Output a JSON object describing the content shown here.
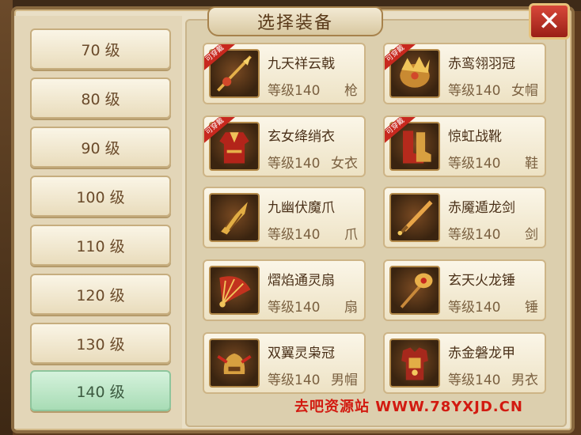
{
  "window": {
    "title": "选择装备",
    "close_label": "✕"
  },
  "levels": [
    {
      "label": "70 级",
      "active": false
    },
    {
      "label": "80 级",
      "active": false
    },
    {
      "label": "90 级",
      "active": false
    },
    {
      "label": "100 级",
      "active": false
    },
    {
      "label": "110 级",
      "active": false
    },
    {
      "label": "120 级",
      "active": false
    },
    {
      "label": "130 级",
      "active": false
    },
    {
      "label": "140 级",
      "active": true
    }
  ],
  "items": [
    {
      "name": "九天祥云戟",
      "level": "等级140",
      "type": "枪",
      "wearable": true,
      "badge": "可穿戴",
      "icon": "spear-icon"
    },
    {
      "name": "赤鸾翎羽冠",
      "level": "等级140",
      "type": "女帽",
      "wearable": true,
      "badge": "可穿戴",
      "icon": "crown-icon"
    },
    {
      "name": "玄女绛绡衣",
      "level": "等级140",
      "type": "女衣",
      "wearable": true,
      "badge": "可穿戴",
      "icon": "robe-icon"
    },
    {
      "name": "惊虹战靴",
      "level": "等级140",
      "type": "鞋",
      "wearable": true,
      "badge": "可穿戴",
      "icon": "boots-icon"
    },
    {
      "name": "九幽伏魔爪",
      "level": "等级140",
      "type": "爪",
      "wearable": false,
      "badge": "",
      "icon": "claw-icon"
    },
    {
      "name": "赤魇遁龙剑",
      "level": "等级140",
      "type": "剑",
      "wearable": false,
      "badge": "",
      "icon": "sword-icon"
    },
    {
      "name": "熠焰通灵扇",
      "level": "等级140",
      "type": "扇",
      "wearable": false,
      "badge": "",
      "icon": "fan-icon"
    },
    {
      "name": "玄天火龙锤",
      "level": "等级140",
      "type": "锤",
      "wearable": false,
      "badge": "",
      "icon": "hammer-icon"
    },
    {
      "name": "双翼灵枭冠",
      "level": "等级140",
      "type": "男帽",
      "wearable": false,
      "badge": "",
      "icon": "helmet-icon"
    },
    {
      "name": "赤金磐龙甲",
      "level": "等级140",
      "type": "男衣",
      "wearable": false,
      "badge": "",
      "icon": "armor-icon"
    }
  ],
  "watermark": "去吧资源站 WWW.78YXJD.CN",
  "colors": {
    "badge": "#c8281e",
    "active_tab": "#a8dcb5",
    "close": "#c0342a"
  }
}
